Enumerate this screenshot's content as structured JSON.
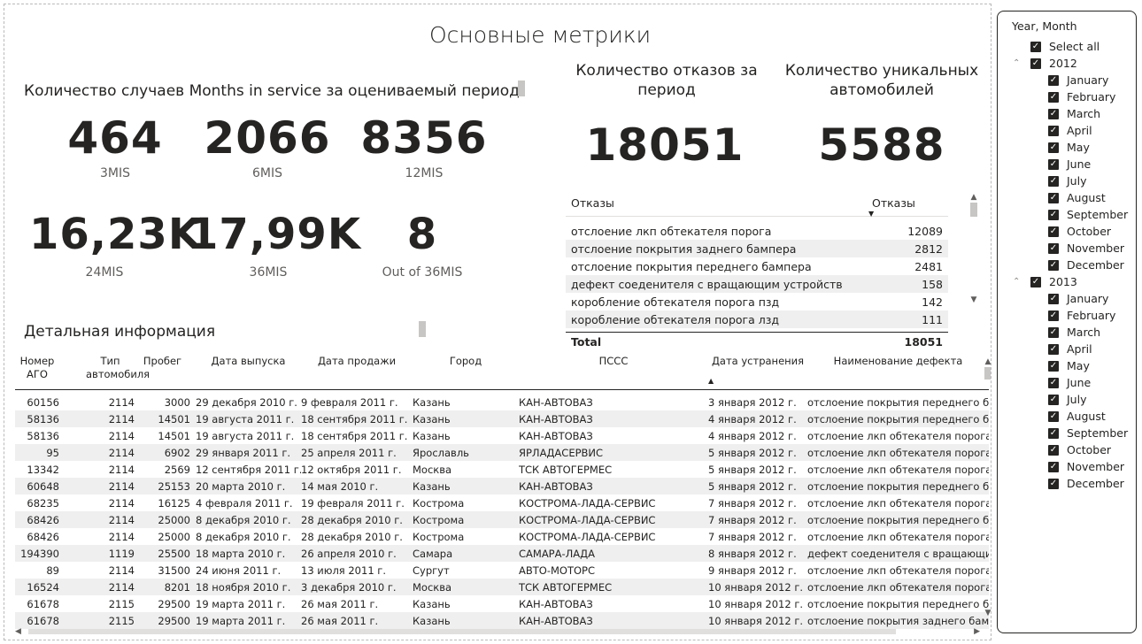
{
  "page_title": "Основные метрики",
  "mis_block": {
    "title": "Количество случаев Months in service за оцениваемый период",
    "kpis": [
      {
        "value": "464",
        "label": "3MIS"
      },
      {
        "value": "2066",
        "label": "6MIS"
      },
      {
        "value": "8356",
        "label": "12MIS"
      },
      {
        "value": "16,23K",
        "label": "24MIS"
      },
      {
        "value": "17,99K",
        "label": "36MIS"
      },
      {
        "value": "8",
        "label": "Out of 36MIS"
      }
    ]
  },
  "failures_kpi": {
    "title": "Количество отказов за период",
    "value": "18051"
  },
  "unique_cars_kpi": {
    "title": "Количество уникальных автомобилей",
    "value": "5588"
  },
  "failures_table": {
    "headers": [
      "Отказы",
      "Отказы"
    ],
    "rows": [
      {
        "name": "отслоение лкп обтекателя порога",
        "count": "12089"
      },
      {
        "name": "отслоение покрытия заднего бампера",
        "count": "2812"
      },
      {
        "name": "отслоение покрытия переднего бампера",
        "count": "2481"
      },
      {
        "name": "дефект соеденителя с вращающим устройств",
        "count": "158"
      },
      {
        "name": "коробление обтекателя порога пзд",
        "count": "142"
      },
      {
        "name": "коробление обтекателя порога лзд",
        "count": "111"
      }
    ],
    "total_label": "Total",
    "total_value": "18051"
  },
  "detail": {
    "title": "Детальная информация",
    "headers": {
      "ago": "Номер АГО",
      "type": "Тип автомобиля",
      "km": "Пробег",
      "release": "Дата выпуска",
      "sale": "Дата продажи",
      "city": "Город",
      "pscc": "ПССС",
      "fix": "Дата устранения",
      "defect": "Наименование дефекта"
    },
    "rows": [
      [
        "60156",
        "2114",
        "3000",
        "29 декабря 2010 г.",
        "9 февраля 2011 г.",
        "Казань",
        "КАН-АВТОВАЗ",
        "3 января 2012 г.",
        "отслоение покрытия переднего бам"
      ],
      [
        "58136",
        "2114",
        "14501",
        "19 августа 2011 г.",
        "18 сентября 2011 г.",
        "Казань",
        "КАН-АВТОВАЗ",
        "4 января 2012 г.",
        "отслоение покрытия переднего бам"
      ],
      [
        "58136",
        "2114",
        "14501",
        "19 августа 2011 г.",
        "18 сентября 2011 г.",
        "Казань",
        "КАН-АВТОВАЗ",
        "4 января 2012 г.",
        "отслоение лкп обтекателя порога"
      ],
      [
        "95",
        "2114",
        "6902",
        "29 января 2011 г.",
        "25 апреля 2011 г.",
        "Ярославль",
        "ЯРЛАДАСЕРВИС",
        "5 января 2012 г.",
        "отслоение лкп обтекателя порога"
      ],
      [
        "13342",
        "2114",
        "2569",
        "12 сентября 2011 г.",
        "12 октября 2011 г.",
        "Москва",
        "ТСК АВТОГЕРМЕС",
        "5 января 2012 г.",
        "отслоение лкп обтекателя порога"
      ],
      [
        "60648",
        "2114",
        "25153",
        "20 марта 2010 г.",
        "14 мая 2010 г.",
        "Казань",
        "КАН-АВТОВАЗ",
        "5 января 2012 г.",
        "отслоение покрытия переднего бам"
      ],
      [
        "68235",
        "2114",
        "16125",
        "4 февраля 2011 г.",
        "19 февраля 2011 г.",
        "Кострома",
        "КОСТРОМА-ЛАДА-СЕРВИС",
        "7 января 2012 г.",
        "отслоение лкп обтекателя порога"
      ],
      [
        "68426",
        "2114",
        "25000",
        "8 декабря 2010 г.",
        "28 декабря 2010 г.",
        "Кострома",
        "КОСТРОМА-ЛАДА-СЕРВИС",
        "7 января 2012 г.",
        "отслоение покрытия переднего бам"
      ],
      [
        "68426",
        "2114",
        "25000",
        "8 декабря 2010 г.",
        "28 декабря 2010 г.",
        "Кострома",
        "КОСТРОМА-ЛАДА-СЕРВИС",
        "7 января 2012 г.",
        "отслоение лкп обтекателя порога"
      ],
      [
        "194390",
        "1119",
        "25500",
        "18 марта 2010 г.",
        "26 апреля 2010 г.",
        "Самара",
        "САМАРА-ЛАДА",
        "8 января 2012 г.",
        "дефект соеденителя с вращающим у"
      ],
      [
        "89",
        "2114",
        "31500",
        "24 июня 2011 г.",
        "13 июля 2011 г.",
        "Сургут",
        "АВТО-МОТОРС",
        "9 января 2012 г.",
        "отслоение лкп обтекателя порога"
      ],
      [
        "16524",
        "2114",
        "8201",
        "18 ноября 2010 г.",
        "3 декабря 2010 г.",
        "Москва",
        "ТСК АВТОГЕРМЕС",
        "10 января 2012 г.",
        "отслоение лкп обтекателя порога"
      ],
      [
        "61678",
        "2115",
        "29500",
        "19 марта 2011 г.",
        "26 мая 2011 г.",
        "Казань",
        "КАН-АВТОВАЗ",
        "10 января 2012 г.",
        "отслоение покрытия переднего бам"
      ],
      [
        "61678",
        "2115",
        "29500",
        "19 марта 2011 г.",
        "26 мая 2011 г.",
        "Казань",
        "КАН-АВТОВАЗ",
        "10 января 2012 г.",
        "отслоение покрытия заднего бампе"
      ]
    ]
  },
  "slicer": {
    "title": "Year, Month",
    "select_all": "Select all",
    "years": [
      {
        "year": "2012",
        "months": [
          "January",
          "February",
          "March",
          "April",
          "May",
          "June",
          "July",
          "August",
          "September",
          "October",
          "November",
          "December"
        ]
      },
      {
        "year": "2013",
        "months": [
          "January",
          "February",
          "March",
          "April",
          "May",
          "June",
          "July",
          "August",
          "September",
          "October",
          "November",
          "December"
        ]
      }
    ],
    "check_glyph": "✓",
    "expand_glyph": "⌃"
  }
}
